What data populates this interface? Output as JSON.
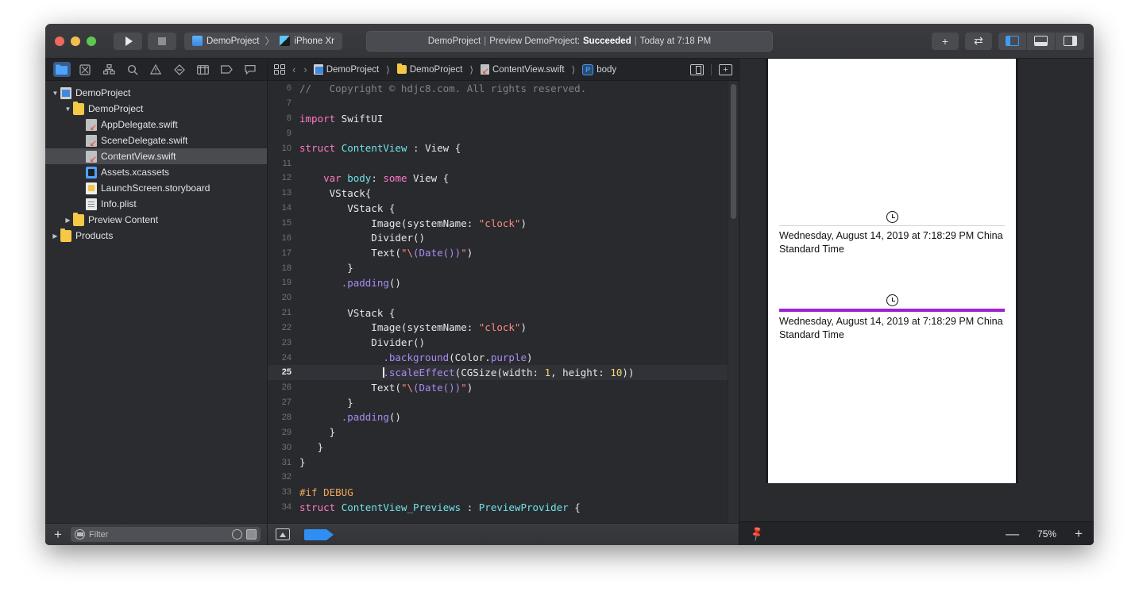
{
  "toolbar": {
    "run_icon": "play-icon",
    "stop_icon": "stop-icon",
    "scheme_name": "DemoProject",
    "scheme_sep": "〉",
    "destination_name": "iPhone Xr",
    "status_project": "DemoProject",
    "status_action": "Preview DemoProject:",
    "status_result": "Succeeded",
    "status_time": "Today at 7:18 PM",
    "status_sep": "|",
    "add_label": "+",
    "swap_label": "⇄"
  },
  "navigator": {
    "tabs": [
      {
        "name": "project-navigator",
        "icon": "folder-icon",
        "active": true
      },
      {
        "name": "source-control-navigator",
        "icon": "source-control-icon",
        "active": false
      },
      {
        "name": "symbol-navigator",
        "icon": "hierarchy-icon",
        "active": false
      },
      {
        "name": "find-navigator",
        "icon": "search-icon",
        "active": false
      },
      {
        "name": "issue-navigator",
        "icon": "warning-triangle-icon",
        "active": false
      },
      {
        "name": "test-navigator",
        "icon": "diamond-icon",
        "active": false
      },
      {
        "name": "debug-navigator",
        "icon": "table-icon",
        "active": false
      },
      {
        "name": "breakpoint-navigator",
        "icon": "breakpoint-tag-icon",
        "active": false
      },
      {
        "name": "report-navigator",
        "icon": "speech-bubble-icon",
        "active": false
      }
    ],
    "tree": [
      {
        "label": "DemoProject",
        "indent": 0,
        "twisty": "open",
        "icon": "proj",
        "selected": false
      },
      {
        "label": "DemoProject",
        "indent": 1,
        "twisty": "open",
        "icon": "folder",
        "selected": false
      },
      {
        "label": "AppDelegate.swift",
        "indent": 2,
        "twisty": "none",
        "icon": "swift",
        "selected": false
      },
      {
        "label": "SceneDelegate.swift",
        "indent": 2,
        "twisty": "none",
        "icon": "swift",
        "selected": false
      },
      {
        "label": "ContentView.swift",
        "indent": 2,
        "twisty": "none",
        "icon": "swift",
        "selected": true
      },
      {
        "label": "Assets.xcassets",
        "indent": 2,
        "twisty": "none",
        "icon": "assets",
        "selected": false
      },
      {
        "label": "LaunchScreen.storyboard",
        "indent": 2,
        "twisty": "none",
        "icon": "story",
        "selected": false
      },
      {
        "label": "Info.plist",
        "indent": 2,
        "twisty": "none",
        "icon": "plist",
        "selected": false
      },
      {
        "label": "Preview Content",
        "indent": 1,
        "twisty": "closed",
        "icon": "folder",
        "selected": false
      },
      {
        "label": "Products",
        "indent": 0,
        "twisty": "closed",
        "icon": "folder",
        "selected": false
      }
    ],
    "filter_placeholder": "Filter",
    "add_button": "+"
  },
  "jumpbar": {
    "back": "‹",
    "forward": "›",
    "crumbs": [
      {
        "label": "DemoProject",
        "icon": "project-icon"
      },
      {
        "label": "DemoProject",
        "icon": "folder-icon"
      },
      {
        "label": "ContentView.swift",
        "icon": "swift-file-icon"
      },
      {
        "label": "body",
        "icon": "property-icon"
      }
    ],
    "property_badge": "P"
  },
  "editor": {
    "lines": [
      {
        "n": 6,
        "highlight": false,
        "tokens": [
          {
            "t": "// ",
            "c": "cm"
          },
          {
            "t": "  Copyright © hdjc8.com. All rights reserved.",
            "c": "cm"
          }
        ]
      },
      {
        "n": 7,
        "highlight": false,
        "tokens": []
      },
      {
        "n": 8,
        "highlight": false,
        "tokens": [
          {
            "t": "import",
            "c": "kw"
          },
          {
            "t": " SwiftUI",
            "c": "plain"
          }
        ]
      },
      {
        "n": 9,
        "highlight": false,
        "tokens": []
      },
      {
        "n": 10,
        "highlight": false,
        "tokens": [
          {
            "t": "struct",
            "c": "kw"
          },
          {
            "t": " ",
            "c": "plain"
          },
          {
            "t": "ContentView",
            "c": "ty"
          },
          {
            "t": " : ",
            "c": "plain"
          },
          {
            "t": "View",
            "c": "plain"
          },
          {
            "t": " {",
            "c": "plain"
          }
        ]
      },
      {
        "n": 11,
        "highlight": false,
        "tokens": []
      },
      {
        "n": 12,
        "highlight": false,
        "tokens": [
          {
            "t": "    ",
            "c": "plain"
          },
          {
            "t": "var",
            "c": "kw"
          },
          {
            "t": " ",
            "c": "plain"
          },
          {
            "t": "body",
            "c": "ty"
          },
          {
            "t": ": ",
            "c": "plain"
          },
          {
            "t": "some",
            "c": "kw"
          },
          {
            "t": " View {",
            "c": "plain"
          }
        ]
      },
      {
        "n": 13,
        "highlight": false,
        "tokens": [
          {
            "t": "     VStack{",
            "c": "plain"
          }
        ]
      },
      {
        "n": 14,
        "highlight": false,
        "tokens": [
          {
            "t": "        VStack {",
            "c": "plain"
          }
        ]
      },
      {
        "n": 15,
        "highlight": false,
        "tokens": [
          {
            "t": "            Image(systemName: ",
            "c": "plain"
          },
          {
            "t": "\"clock\"",
            "c": "st"
          },
          {
            "t": ")",
            "c": "plain"
          }
        ]
      },
      {
        "n": 16,
        "highlight": false,
        "tokens": [
          {
            "t": "            Divider()",
            "c": "plain"
          }
        ]
      },
      {
        "n": 17,
        "highlight": false,
        "tokens": [
          {
            "t": "            Text(",
            "c": "plain"
          },
          {
            "t": "\"\\",
            "c": "st"
          },
          {
            "t": "(Date())",
            "c": "fn"
          },
          {
            "t": "\"",
            "c": "st"
          },
          {
            "t": ")",
            "c": "plain"
          }
        ]
      },
      {
        "n": 18,
        "highlight": false,
        "tokens": [
          {
            "t": "        }",
            "c": "plain"
          }
        ]
      },
      {
        "n": 19,
        "highlight": false,
        "tokens": [
          {
            "t": "       ",
            "c": "plain"
          },
          {
            "t": ".padding",
            "c": "fn"
          },
          {
            "t": "()",
            "c": "plain"
          }
        ]
      },
      {
        "n": 20,
        "highlight": false,
        "tokens": []
      },
      {
        "n": 21,
        "highlight": false,
        "tokens": [
          {
            "t": "        VStack {",
            "c": "plain"
          }
        ]
      },
      {
        "n": 22,
        "highlight": false,
        "tokens": [
          {
            "t": "            Image(systemName: ",
            "c": "plain"
          },
          {
            "t": "\"clock\"",
            "c": "st"
          },
          {
            "t": ")",
            "c": "plain"
          }
        ]
      },
      {
        "n": 23,
        "highlight": false,
        "tokens": [
          {
            "t": "            Divider()",
            "c": "plain"
          }
        ]
      },
      {
        "n": 24,
        "highlight": false,
        "tokens": [
          {
            "t": "              ",
            "c": "plain"
          },
          {
            "t": ".background",
            "c": "fn"
          },
          {
            "t": "(Color.",
            "c": "plain"
          },
          {
            "t": "purple",
            "c": "fn"
          },
          {
            "t": ")",
            "c": "plain"
          }
        ]
      },
      {
        "n": 25,
        "highlight": true,
        "caret": true,
        "tokens": [
          {
            "t": "              ",
            "c": "plain"
          },
          {
            "t": ".scaleEffect",
            "c": "fn"
          },
          {
            "t": "(CGSize(width: ",
            "c": "plain"
          },
          {
            "t": "1",
            "c": "nm"
          },
          {
            "t": ", height: ",
            "c": "plain"
          },
          {
            "t": "10",
            "c": "nm"
          },
          {
            "t": "))",
            "c": "plain"
          }
        ]
      },
      {
        "n": 26,
        "highlight": false,
        "tokens": [
          {
            "t": "            Text(",
            "c": "plain"
          },
          {
            "t": "\"\\",
            "c": "st"
          },
          {
            "t": "(Date())",
            "c": "fn"
          },
          {
            "t": "\"",
            "c": "st"
          },
          {
            "t": ")",
            "c": "plain"
          }
        ]
      },
      {
        "n": 27,
        "highlight": false,
        "tokens": [
          {
            "t": "        }",
            "c": "plain"
          }
        ]
      },
      {
        "n": 28,
        "highlight": false,
        "tokens": [
          {
            "t": "       ",
            "c": "plain"
          },
          {
            "t": ".padding",
            "c": "fn"
          },
          {
            "t": "()",
            "c": "plain"
          }
        ]
      },
      {
        "n": 29,
        "highlight": false,
        "tokens": [
          {
            "t": "     }",
            "c": "plain"
          }
        ]
      },
      {
        "n": 30,
        "highlight": false,
        "tokens": [
          {
            "t": "   }",
            "c": "plain"
          }
        ]
      },
      {
        "n": 31,
        "highlight": false,
        "tokens": [
          {
            "t": "}",
            "c": "plain"
          }
        ]
      },
      {
        "n": 32,
        "highlight": false,
        "tokens": []
      },
      {
        "n": 33,
        "highlight": false,
        "tokens": [
          {
            "t": "#if DEBUG",
            "c": "pp"
          }
        ]
      },
      {
        "n": 34,
        "highlight": false,
        "tokens": [
          {
            "t": "struct",
            "c": "kw"
          },
          {
            "t": " ",
            "c": "plain"
          },
          {
            "t": "ContentView_Previews",
            "c": "ty"
          },
          {
            "t": " : ",
            "c": "plain"
          },
          {
            "t": "PreviewProvider",
            "c": "ty"
          },
          {
            "t": " {",
            "c": "plain"
          }
        ]
      }
    ]
  },
  "preview": {
    "blocks": [
      {
        "icon": "clock-icon",
        "divider": "thin",
        "text": "Wednesday, August 14, 2019 at 7:18:29 PM China Standard Time"
      },
      {
        "icon": "clock-icon",
        "divider": "purple",
        "text": "Wednesday, August 14, 2019 at 7:18:29 PM China Standard Time"
      }
    ],
    "pin_icon": "pin-icon",
    "zoom_out": "—",
    "zoom_value": "75%",
    "zoom_in": "+"
  },
  "colors": {
    "accent_blue": "#3f9bf5",
    "purple_divider": "#a020d0",
    "selected_row": "#4a4b50",
    "window_bg": "#292a2e"
  }
}
